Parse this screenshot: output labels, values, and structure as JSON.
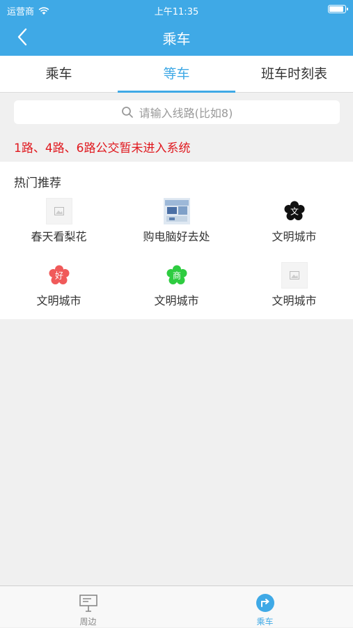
{
  "status": {
    "carrier": "运营商",
    "time": "上午11:35"
  },
  "nav": {
    "title": "乘车"
  },
  "tabs": [
    {
      "label": "乘车"
    },
    {
      "label": "等车",
      "active": true
    },
    {
      "label": "班车时刻表"
    }
  ],
  "search": {
    "placeholder": "请输入线路(比如8)"
  },
  "notice": "1路、4路、6路公交暂未进入系统",
  "hot": {
    "heading": "热门推荐",
    "items": [
      {
        "label": "春天看梨花",
        "icon": "image-placeholder-icon"
      },
      {
        "label": "购电脑好去处",
        "icon": "computer-photo-icon"
      },
      {
        "label": "文明城市",
        "icon": "flower-badge-icon",
        "color": "#111111",
        "char": "文"
      },
      {
        "label": "文明城市",
        "icon": "flower-badge-icon",
        "color": "#f05a5a",
        "char": "好"
      },
      {
        "label": "文明城市",
        "icon": "flower-badge-icon",
        "color": "#2ecc40",
        "char": "商"
      },
      {
        "label": "文明城市",
        "icon": "image-placeholder-icon"
      }
    ]
  },
  "tabbar": [
    {
      "label": "周边",
      "icon": "nearby-board-icon"
    },
    {
      "label": "乘车",
      "icon": "ride-icon",
      "active": true
    }
  ],
  "colors": {
    "accent": "#3fa9e6",
    "notice": "#e0181e",
    "background": "#f0f0f0"
  }
}
